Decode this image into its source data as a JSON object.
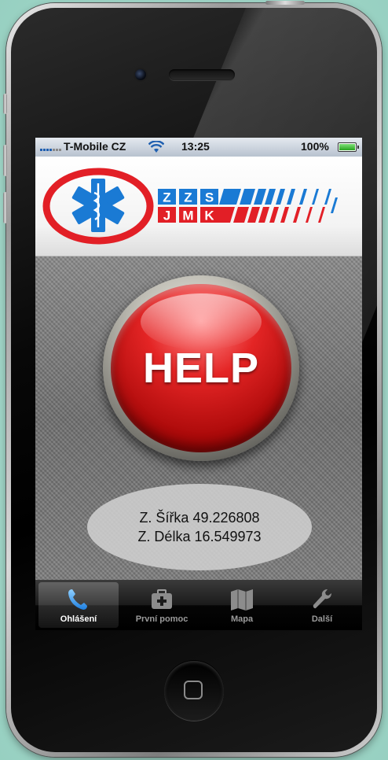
{
  "status_bar": {
    "carrier": "T-Mobile CZ",
    "time": "13:25",
    "battery": "100%",
    "battery_level": 1.0
  },
  "header": {
    "logo_letters_top": [
      "Z",
      "Z",
      "S"
    ],
    "logo_letters_bottom": [
      "J",
      "M",
      "K"
    ]
  },
  "help_button": {
    "label": "HELP"
  },
  "location": {
    "latitude": "Z. Šířka 49.226808",
    "longitude": "Z. Délka 16.549973"
  },
  "tabs": [
    {
      "label": "Ohlášení",
      "icon": "phone-icon",
      "active": true
    },
    {
      "label": "První pomoc",
      "icon": "first-aid-kit-icon",
      "active": false
    },
    {
      "label": "Mapa",
      "icon": "map-icon",
      "active": false
    },
    {
      "label": "Další",
      "icon": "wrench-icon",
      "active": false
    }
  ],
  "colors": {
    "accent_red": "#d71c1c",
    "logo_blue": "#1a7ad4",
    "logo_red": "#e21f26",
    "tab_active": "#4aa8ff"
  }
}
